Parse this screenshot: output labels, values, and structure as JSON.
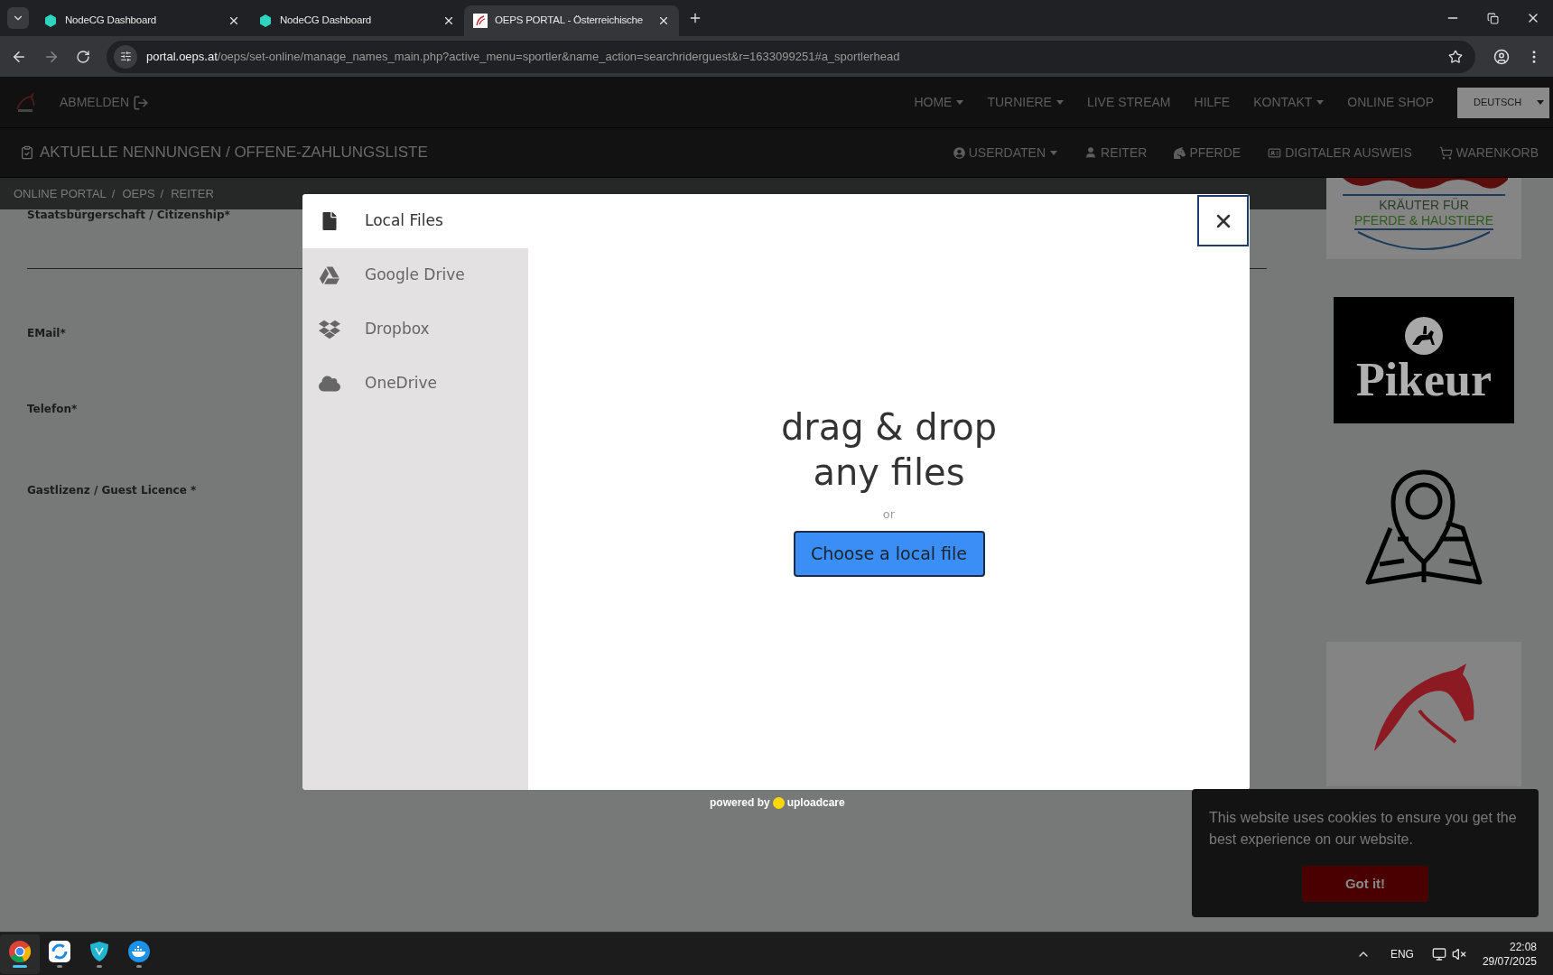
{
  "browser": {
    "tabs": [
      {
        "title": "NodeCG Dashboard",
        "kind": "nodecg",
        "selected": false
      },
      {
        "title": "NodeCG Dashboard",
        "kind": "nodecg",
        "selected": false
      },
      {
        "title": "OEPS PORTAL - Österreichische",
        "kind": "oeps",
        "selected": true
      }
    ],
    "url_host": "portal.oeps.at",
    "url_path": "/oeps/set-online/manage_names_main.php?active_menu=sportler&name_action=searchriderguest&r=1633099251#a_sportlerhead"
  },
  "site_nav": {
    "logout": "ABMELDEN",
    "items": [
      {
        "label": "HOME",
        "dropdown": true
      },
      {
        "label": "TURNIERE",
        "dropdown": true
      },
      {
        "label": "LIVE STREAM",
        "dropdown": false
      },
      {
        "label": "HILFE",
        "dropdown": false
      },
      {
        "label": "KONTAKT",
        "dropdown": true
      },
      {
        "label": "ONLINE SHOP",
        "dropdown": false
      }
    ],
    "language": "DEUTSCH"
  },
  "page_title": "AKTUELLE NENNUNGEN / OFFENE-ZAHLUNGSLISTE",
  "user_nav": [
    {
      "label": "USERDATEN",
      "kind": "user-circle",
      "dropdown": true
    },
    {
      "label": "REITER",
      "kind": "user",
      "dropdown": false
    },
    {
      "label": "PFERDE",
      "kind": "horse",
      "dropdown": false
    },
    {
      "label": "DIGITALER AUSWEIS",
      "kind": "id-card",
      "dropdown": false
    },
    {
      "label": "WARENKORB",
      "kind": "cart",
      "dropdown": false
    }
  ],
  "breadcrumbs": [
    {
      "label": "ONLINE PORTAL",
      "separator": "/"
    },
    {
      "label": "OEPS",
      "separator": "/"
    },
    {
      "label": "REITER"
    }
  ],
  "form_labels": [
    "Staatsbürgerschaft / Citizenship*",
    "EMail*",
    "Telefon*",
    "Gastlizenz / Guest Licence *"
  ],
  "ads": [
    {
      "kind": "herbs",
      "lines": [
        "KRÄUTER FÜR",
        "PFERDE & HAUSTIERE"
      ]
    },
    {
      "kind": "pikeur",
      "text": "Pikeur"
    },
    {
      "kind": "map"
    },
    {
      "kind": "horse"
    }
  ],
  "upload_dialog": {
    "sources": [
      {
        "label": "Local Files",
        "kind": "file",
        "selected": true
      },
      {
        "label": "Google Drive",
        "kind": "gdrive",
        "selected": false
      },
      {
        "label": "Dropbox",
        "kind": "dropbox",
        "selected": false
      },
      {
        "label": "OneDrive",
        "kind": "cloud",
        "selected": false
      }
    ],
    "drop_text": [
      "drag & drop",
      "any files"
    ],
    "or": "or",
    "choose_button": "Choose a local file",
    "powered_by": "powered by",
    "brand": "uploadcare"
  },
  "cookie_banner": {
    "message": "This website uses cookies to ensure you get the best experience on our website.",
    "button": "Got it!"
  },
  "taskbar": {
    "apps": [
      {
        "kind": "chrome",
        "selected": true
      },
      {
        "kind": "sync",
        "selected": false
      },
      {
        "kind": "shield",
        "selected": false
      },
      {
        "kind": "docker",
        "selected": false
      }
    ],
    "language": "ENG",
    "time": "22:08",
    "date": "29/07/2025"
  }
}
